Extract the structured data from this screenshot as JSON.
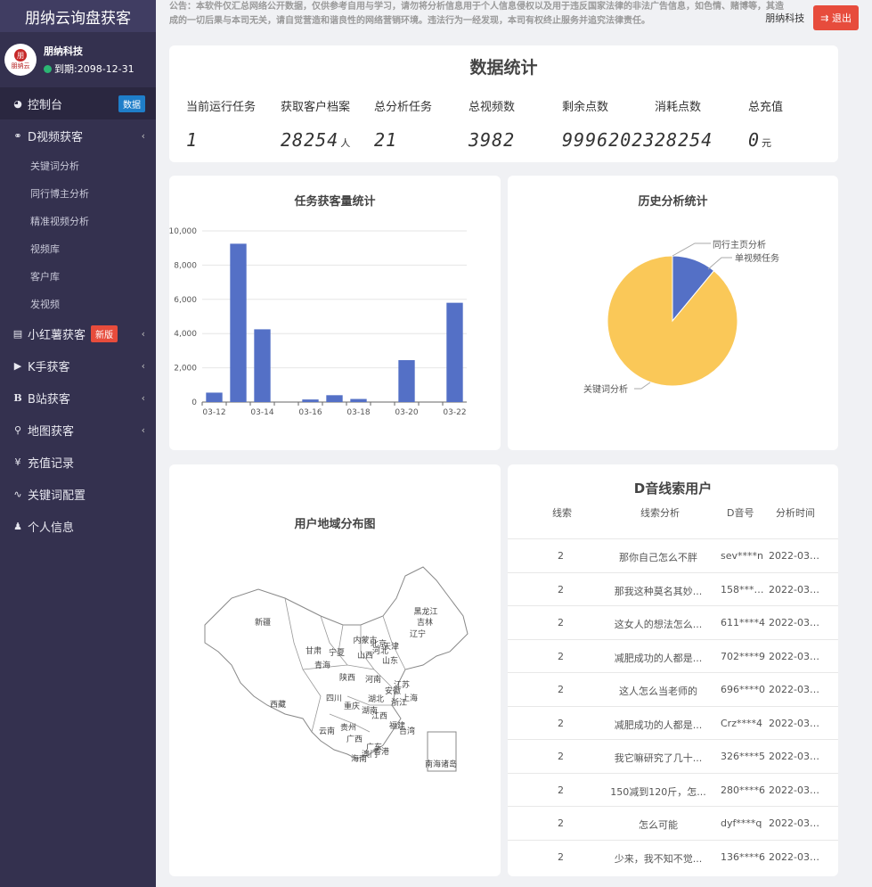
{
  "app": {
    "title": "朋纳云询盘获客"
  },
  "user": {
    "name": "朋纳科技",
    "expire": "到期:2098-12-31",
    "avatar_text": "朋纳云"
  },
  "menu": {
    "dashboard": {
      "label": "控制台",
      "badge": "数据"
    },
    "douyin": {
      "label": "D视频获客",
      "subs": [
        "关键词分析",
        "同行博主分析",
        "精准视频分析",
        "视频库",
        "客户库",
        "发视频"
      ]
    },
    "xiaohongshu": {
      "label": "小红薯获客",
      "badge": "新版"
    },
    "kuaishou": {
      "label": "K手获客"
    },
    "bilibili": {
      "label": "B站获客"
    },
    "map": {
      "label": "地图获客"
    },
    "recharge": {
      "label": "充值记录"
    },
    "keywords": {
      "label": "关键词配置"
    },
    "profile": {
      "label": "个人信息"
    }
  },
  "notice": "公告：本软件仅汇总网络公开数据，仅供参考自用与学习，请勿将分析信息用于个人信息侵权以及用于违反国家法律的非法广告信息，如色情、赌博等，其造成的一切后果与本司无关，请自觉营造和谐良性的网络营销环境。违法行为一经发现，本司有权终止服务并追究法律责任。",
  "header": {
    "user": "朋纳科技",
    "logout": "退出"
  },
  "stats": {
    "title": "数据统计",
    "items": [
      {
        "label": "当前运行任务",
        "value": "1",
        "unit": ""
      },
      {
        "label": "获取客户档案",
        "value": "28254",
        "unit": "人"
      },
      {
        "label": "总分析任务",
        "value": "21",
        "unit": ""
      },
      {
        "label": "总视频数",
        "value": "3982",
        "unit": ""
      },
      {
        "label": "剩余点数",
        "value": "99962023",
        "unit": ""
      },
      {
        "label": "消耗点数",
        "value": "28254",
        "unit": ""
      },
      {
        "label": "总充值",
        "value": "0",
        "unit": "元"
      }
    ]
  },
  "chart_titles": {
    "bar": "任务获客量统计",
    "pie": "历史分析统计",
    "map": "用户地域分布图",
    "table": "D音线索用户"
  },
  "chart_data": [
    {
      "type": "bar",
      "title": "任务获客量统计",
      "categories": [
        "03-12",
        "03-13",
        "03-14",
        "03-15",
        "03-16",
        "03-17",
        "03-18",
        "03-19",
        "03-20",
        "03-21",
        "03-22"
      ],
      "tick_labels": [
        "03-12",
        "03-14",
        "03-16",
        "03-18",
        "03-20",
        "03-22"
      ],
      "values": [
        550,
        9250,
        4250,
        0,
        150,
        400,
        180,
        0,
        2450,
        0,
        5800
      ],
      "ylim": [
        0,
        10000
      ],
      "yticks": [
        "0",
        "2,000",
        "4,000",
        "6,000",
        "8,000",
        "10,000"
      ],
      "color": "#5470c6"
    },
    {
      "type": "pie",
      "title": "历史分析统计",
      "labels": [
        "同行主页分析",
        "单视频任务",
        "关键词分析"
      ],
      "values": [
        0,
        11,
        89
      ],
      "colors": [
        "#91cc75",
        "#5470c6",
        "#fac858"
      ]
    }
  ],
  "map_labels": [
    "新疆",
    "西藏",
    "内蒙古",
    "黑龙江",
    "吉林",
    "辽宁",
    "青海",
    "甘肃",
    "宁夏",
    "陕西",
    "山西",
    "河北",
    "北京",
    "天津",
    "山东",
    "河南",
    "四川",
    "重庆",
    "湖北",
    "安徽",
    "江苏",
    "上海",
    "浙江",
    "湖南",
    "江西",
    "福建",
    "贵州",
    "云南",
    "广西",
    "广东",
    "香港",
    "澳门",
    "台湾",
    "海南",
    "南海诸岛"
  ],
  "table": {
    "headers": [
      "线索",
      "线索分析",
      "D音号",
      "分析时间"
    ],
    "rows": [
      [
        "2",
        "那你自己怎么不胖",
        "sev****n",
        "2022-03-..."
      ],
      [
        "2",
        "那我这种莫名其妙...",
        "158****A",
        "2022-03-..."
      ],
      [
        "2",
        "这女人的想法怎么...",
        "611****4",
        "2022-03-..."
      ],
      [
        "2",
        "减肥成功的人都是...",
        "702****9",
        "2022-03-..."
      ],
      [
        "2",
        "这人怎么当老师的",
        "696****0",
        "2022-03-..."
      ],
      [
        "2",
        "减肥成功的人都是...",
        "Crz****4",
        "2022-03-..."
      ],
      [
        "2",
        "我它嘛研究了几十...",
        "326****5",
        "2022-03-..."
      ],
      [
        "2",
        "150减到120斤，怎...",
        "280****6",
        "2022-03-..."
      ],
      [
        "2",
        "怎么可能",
        "dyf****q",
        "2022-03-..."
      ],
      [
        "2",
        "少来，我不知不觉...",
        "136****6",
        "2022-03-..."
      ]
    ]
  }
}
